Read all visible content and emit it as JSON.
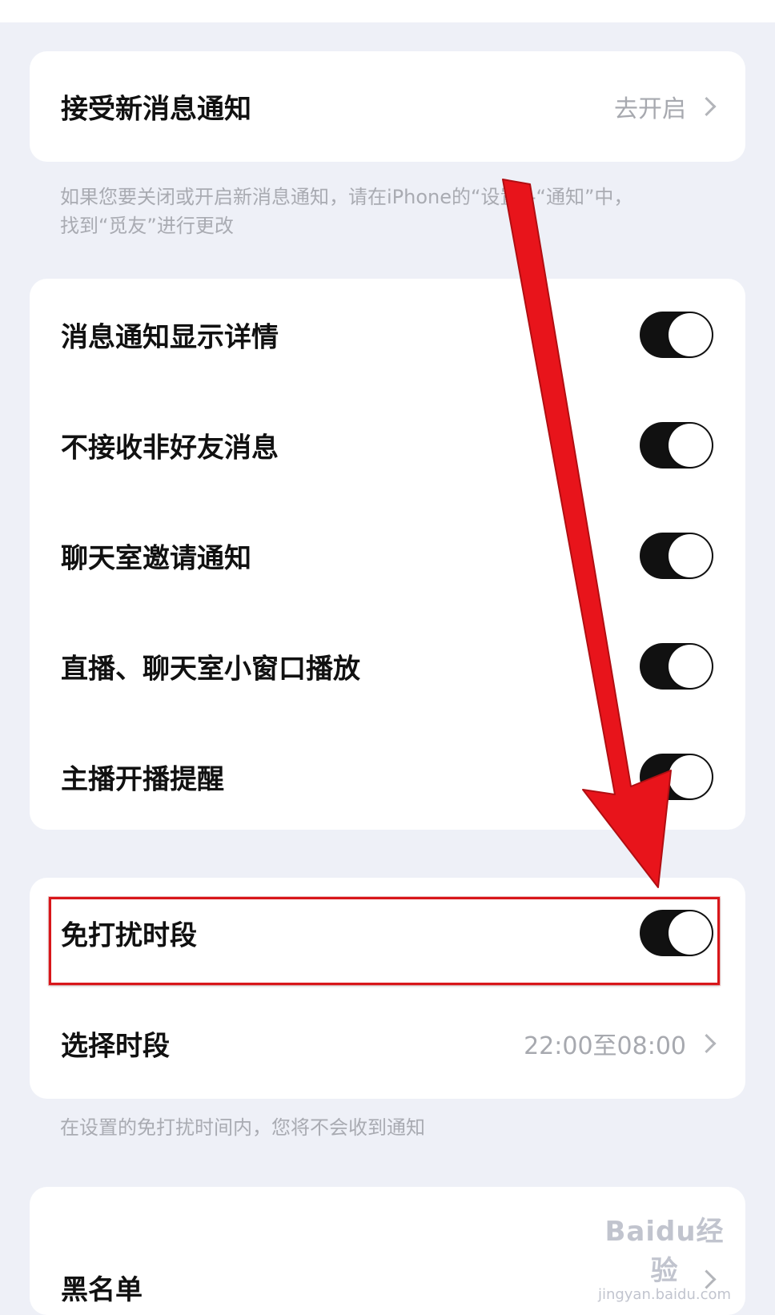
{
  "notifications": {
    "receive_label": "接受新消息通知",
    "receive_action": "去开启"
  },
  "notice_note_line1": "如果您要关闭或开启新消息通知，请在iPhone的“设置”-“通知”中，",
  "notice_note_line2": "找到“觅友”进行更改",
  "toggles": [
    {
      "label": "消息通知显示详情",
      "on": true
    },
    {
      "label": "不接收非好友消息",
      "on": true
    },
    {
      "label": "聊天室邀请通知",
      "on": true
    },
    {
      "label": "直播、聊天室小窗口播放",
      "on": true
    },
    {
      "label": "主播开播提醒",
      "on": true
    }
  ],
  "dnd": {
    "label": "免打扰时段",
    "on": true,
    "select_label": "选择时段",
    "select_value": "22:00至08:00",
    "note": "在设置的免打扰时间内，您将不会收到通知"
  },
  "blacklist": {
    "label": "黑名单"
  },
  "watermark": {
    "brand": "Baidu经验",
    "url": "jingyan.baidu.com"
  },
  "colors": {
    "background": "#eef0f7",
    "toggle_on": "#111111",
    "annotation_red": "#e8141b"
  },
  "icons": {
    "chevron": "chevron-right-icon",
    "annotation_arrow": "arrow-down-icon"
  }
}
